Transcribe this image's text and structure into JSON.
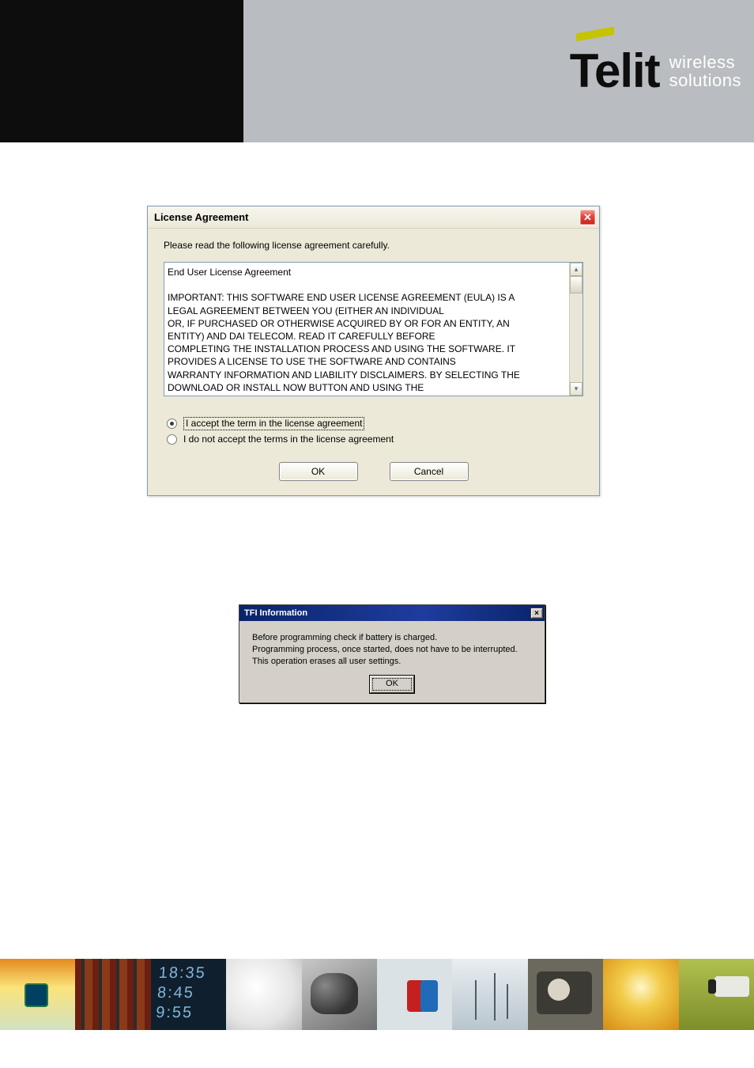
{
  "brand": {
    "name": "Telit",
    "tagline_line1": "wireless",
    "tagline_line2": "solutions"
  },
  "license_dialog": {
    "title": "License Agreement",
    "intro": "Please read the following license agreement carefully.",
    "eula_text": "End User License Agreement\n\nIMPORTANT: THIS SOFTWARE END USER LICENSE AGREEMENT (EULA) IS A\nLEGAL AGREEMENT BETWEEN YOU (EITHER AN INDIVIDUAL\nOR, IF PURCHASED OR OTHERWISE ACQUIRED BY OR FOR AN ENTITY, AN\nENTITY) AND DAI TELECOM. READ IT CAREFULLY BEFORE\nCOMPLETING THE INSTALLATION PROCESS AND USING THE SOFTWARE. IT\nPROVIDES A LICENSE TO USE THE SOFTWARE AND CONTAINS\nWARRANTY INFORMATION AND LIABILITY DISCLAIMERS. BY SELECTING THE\nDOWNLOAD OR INSTALL NOW BUTTON AND USING THE\nSOFTWARE, YOU ARE CONFIRMING YOUR ACCEPTANCE OF THE SOFTWARE AND",
    "accept_label": "I accept the term in the license agreement",
    "decline_label": "I do not accept the terms in the license agreement",
    "ok_label": "OK",
    "cancel_label": "Cancel"
  },
  "tfi_dialog": {
    "title": "TFI Information",
    "line1": "Before programming check if battery is charged.",
    "line2": "Programming process, once started, does not have to be interrupted.",
    "line3": "This operation erases all user settings.",
    "ok_label": "OK"
  },
  "footer_clock": {
    "line1": "18:35",
    "line2": "8:45",
    "line3": "9:55"
  }
}
